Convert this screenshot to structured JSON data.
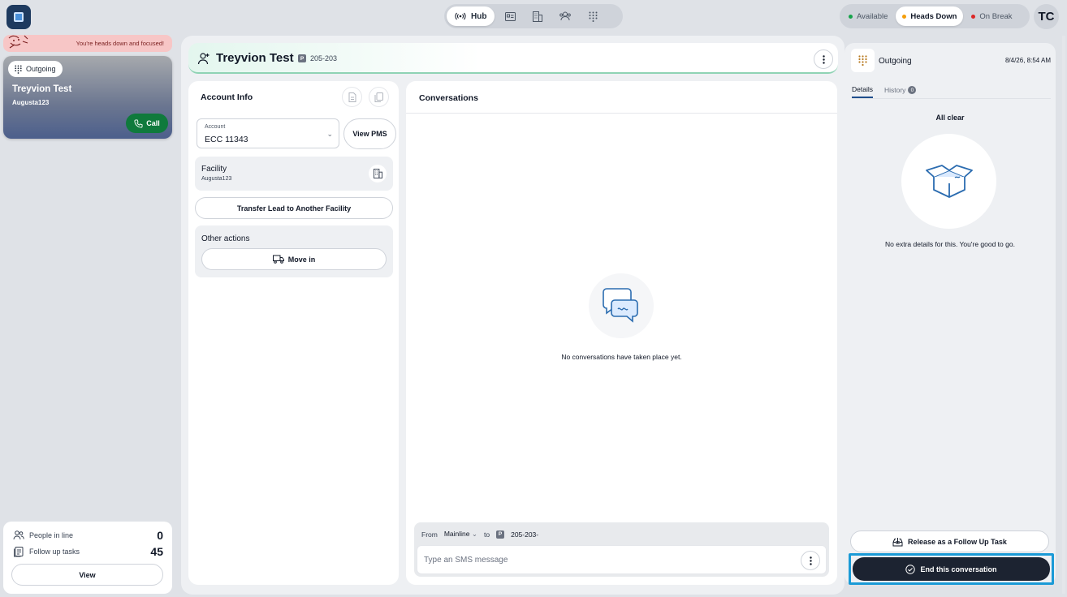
{
  "topbar": {
    "nav": [
      {
        "label": "Hub",
        "icon": "broadcast-icon",
        "active": true
      },
      {
        "label": "",
        "icon": "id-card-icon"
      },
      {
        "label": "",
        "icon": "building-icon"
      },
      {
        "label": "",
        "icon": "users-icon"
      },
      {
        "label": "",
        "icon": "keypad-icon"
      }
    ],
    "statuses": [
      {
        "label": "Available",
        "color": "#16a34a",
        "active": false
      },
      {
        "label": "Heads Down",
        "color": "#f59e0b",
        "active": true
      },
      {
        "label": "On Break",
        "color": "#dc2626",
        "active": false
      }
    ],
    "avatar_initials": "TC"
  },
  "left": {
    "focus_message": "You're heads down and focused!",
    "call_card": {
      "chip_label": "Outgoing",
      "name": "Treyvion Test",
      "sub": "Augusta123",
      "call_label": "Call"
    },
    "queue": {
      "people_label": "People in line",
      "people_count": "0",
      "tasks_label": "Follow up tasks",
      "tasks_count": "45",
      "view_label": "View"
    }
  },
  "header": {
    "name": "Treyvion Test",
    "phone_badge": "P",
    "phone": "205-203"
  },
  "account": {
    "title": "Account Info",
    "select_label": "Account",
    "select_value": "ECC 11343",
    "view_pms_label": "View PMS",
    "facility_label": "Facility",
    "facility_value": "Augusta123",
    "transfer_label": "Transfer Lead to Another Facility",
    "other_title": "Other actions",
    "move_in_label": "Move in"
  },
  "conversations": {
    "title": "Conversations",
    "empty_text": "No conversations have taken place yet.",
    "from_label": "From",
    "from_value": "Mainline",
    "to_label": "to",
    "to_badge": "P",
    "to_value": "205-203-",
    "sms_placeholder": "Type an SMS message"
  },
  "details": {
    "title": "Outgoing",
    "timestamp": "8/4/26, 8:54 AM",
    "tab_details": "Details",
    "tab_history": "History",
    "history_count": "0",
    "all_clear": "All clear",
    "no_extra": "No extra details for this. You're good to go.",
    "release_label": "Release as a Follow Up Task",
    "end_label": "End this conversation"
  }
}
